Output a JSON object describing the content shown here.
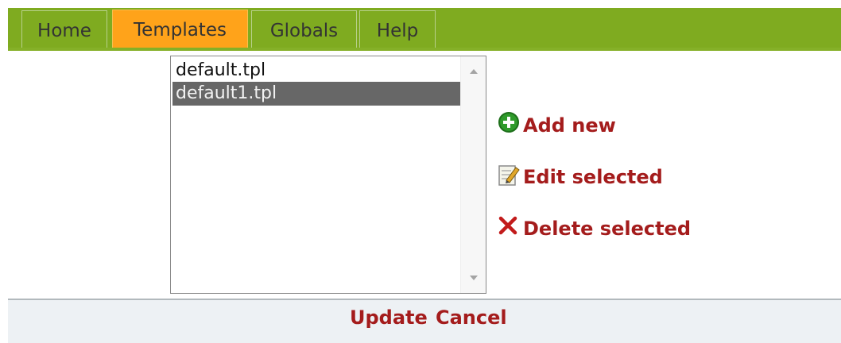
{
  "nav": {
    "tabs": [
      {
        "label": "Home",
        "active": false
      },
      {
        "label": "Templates",
        "active": true
      },
      {
        "label": "Globals",
        "active": false
      },
      {
        "label": "Help",
        "active": false
      }
    ]
  },
  "template_list": {
    "items": [
      {
        "label": "default.tpl",
        "selected": false
      },
      {
        "label": "default1.tpl",
        "selected": true
      }
    ]
  },
  "actions": {
    "add_label": "Add new",
    "edit_label": "Edit selected",
    "delete_label": "Delete selected"
  },
  "footer": {
    "update_label": "Update",
    "cancel_label": "Cancel"
  },
  "colors": {
    "nav_green": "#7fab20",
    "active_tab": "#ffa31a",
    "link_red": "#a41c1c",
    "selection_gray": "#676767"
  },
  "icons": {
    "add": "plus-circle-icon",
    "edit": "pencil-note-icon",
    "delete": "x-icon"
  }
}
